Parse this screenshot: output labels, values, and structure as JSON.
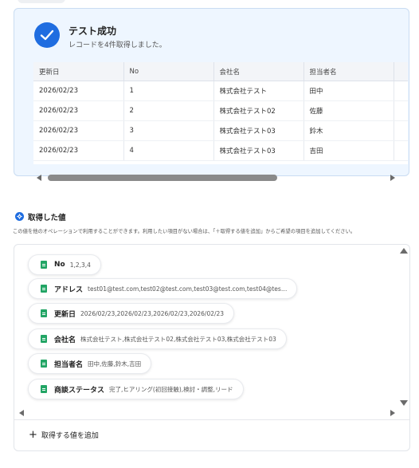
{
  "success": {
    "title": "テスト成功",
    "subtitle": "レコードを4件取得しました。",
    "status_color": "#1f6de0"
  },
  "records_table": {
    "columns": [
      "更新日",
      "No",
      "会社名",
      "担当者名"
    ],
    "rows": [
      [
        "2026/02/23",
        "1",
        "株式会社テスト",
        "田中"
      ],
      [
        "2026/02/23",
        "2",
        "株式会社テスト02",
        "佐藤"
      ],
      [
        "2026/02/23",
        "3",
        "株式会社テスト03",
        "鈴木"
      ],
      [
        "2026/02/23",
        "4",
        "株式会社テスト03",
        "吉田"
      ]
    ]
  },
  "retrieved": {
    "title": "取得した値",
    "description": "この値を他のオペレーションで利用することができます。利用したい項目がない場合は、「＋取得する値を追加」からご希望の項目を追加してください。",
    "items": [
      {
        "label": "No",
        "value": "1,2,3,4"
      },
      {
        "label": "アドレス",
        "value": "test01@test.com,test02@test.com,test03@test.com,test04@tes…"
      },
      {
        "label": "更新日",
        "value": "2026/02/23,2026/02/23,2026/02/23,2026/02/23"
      },
      {
        "label": "会社名",
        "value": "株式会社テスト,株式会社テスト02,株式会社テスト03,株式会社テスト03"
      },
      {
        "label": "担当者名",
        "value": "田中,佐藤,鈴木,吉田"
      },
      {
        "label": "商談ステータス",
        "value": "完了,ヒアリング(初回接触),検討・調整,リード"
      }
    ],
    "add_label": "取得する値を追加",
    "icon_color": "#22a565"
  },
  "icons": {
    "success": "check-icon",
    "section": "settings-badge-icon",
    "items": "spreadsheet-icon",
    "add": "plus-icon"
  }
}
